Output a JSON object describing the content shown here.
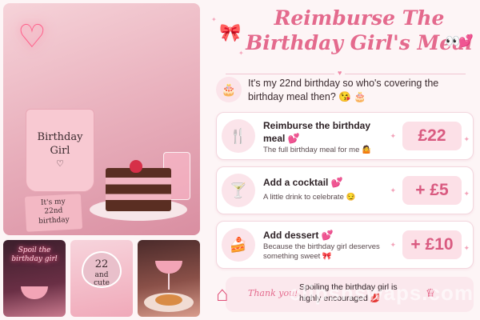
{
  "hero": {
    "mug_line1": "Birthday",
    "mug_line2": "Girl",
    "card_line1": "It's my",
    "card_line2": "22nd",
    "card_line3": "birthday"
  },
  "thumbs": {
    "neon_line1": "Spoil the",
    "neon_line2": "birthday girl",
    "balloon_line1": "22",
    "balloon_line2": "and",
    "balloon_line3": "cute"
  },
  "header": {
    "title_line1": "Reimburse The",
    "title_line2": "Birthday Girl's Meal",
    "eyes": "👀",
    "title_heart": "💕"
  },
  "intro": {
    "text": "It's my 22nd birthday so who's covering the birthday meal then? 😘 🎂"
  },
  "items": [
    {
      "name": "Reimburse the birthday meal 💕",
      "desc": "The full birthday meal for me 🤷",
      "price": "£22",
      "icon": "cutlery-icon"
    },
    {
      "name": "Add a cocktail 💕",
      "desc": "A little drink to celebrate 😏",
      "price": "+ £5",
      "icon": "cocktail-icon"
    },
    {
      "name": "Add dessert 💕",
      "desc": "Because the birthday girl deserves something sweet 🎀",
      "price": "+ £10",
      "icon": "cake-slice-icon"
    }
  ],
  "footer": {
    "thanks": "Thank you!",
    "text": "Spoiling the birthday girl is highly encouraged 💋",
    "watermark": "clipsnswaps.com"
  },
  "colors": {
    "accent": "#e46a8d",
    "price": "#d95a80",
    "background": "#fdf5f6"
  }
}
